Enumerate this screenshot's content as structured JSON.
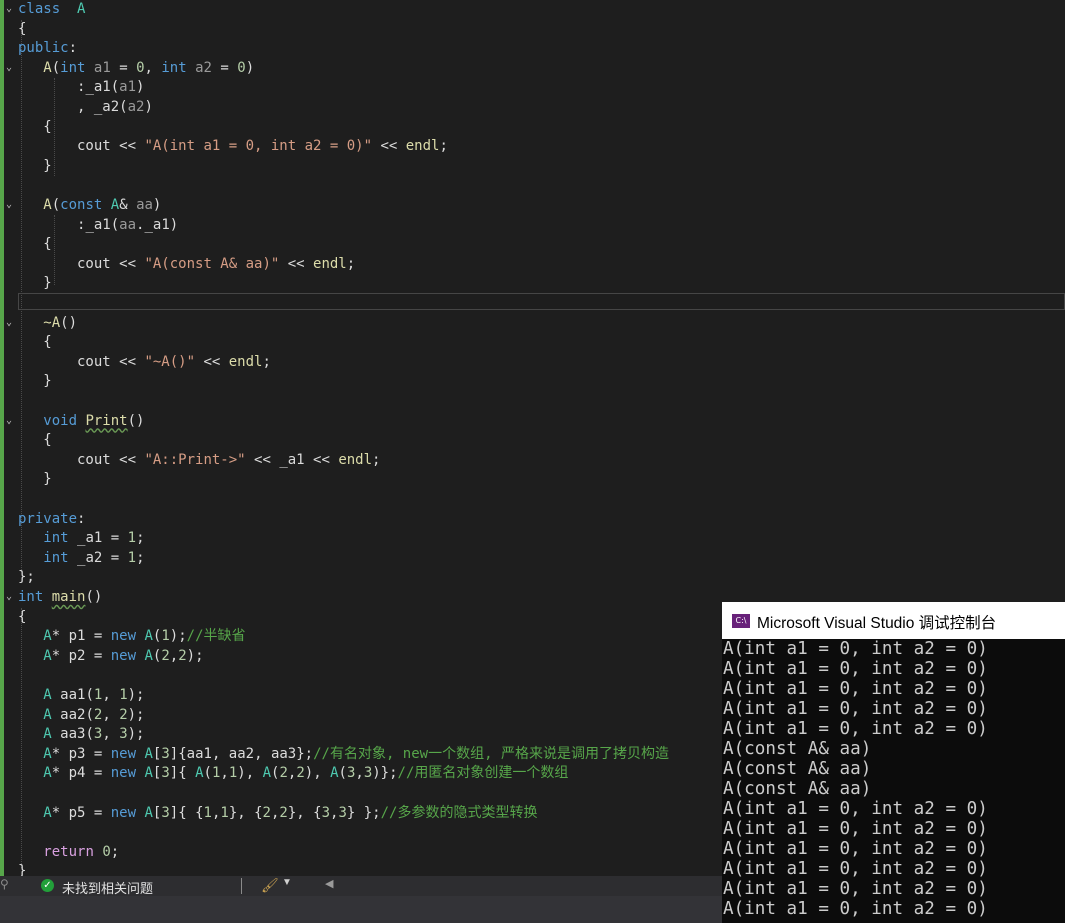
{
  "editor": {
    "code": [
      {
        "parts": [
          [
            "kw",
            "class"
          ],
          [
            "",
            "  "
          ],
          [
            "ty",
            "A"
          ]
        ]
      },
      {
        "parts": [
          [
            "",
            "{"
          ]
        ]
      },
      {
        "parts": [
          [
            "kw",
            "public"
          ],
          [
            "",
            ":"
          ]
        ]
      },
      {
        "parts": [
          [
            "",
            "   "
          ],
          [
            "fn",
            "A"
          ],
          [
            "",
            "("
          ],
          [
            "kw",
            "int"
          ],
          [
            "",
            " "
          ],
          [
            "par",
            "a1"
          ],
          [
            "",
            " = "
          ],
          [
            "num",
            "0"
          ],
          [
            "",
            ", "
          ],
          [
            "kw",
            "int"
          ],
          [
            "",
            " "
          ],
          [
            "par",
            "a2"
          ],
          [
            "",
            " = "
          ],
          [
            "num",
            "0"
          ],
          [
            "",
            ")"
          ]
        ]
      },
      {
        "parts": [
          [
            "",
            "       :"
          ],
          [
            "mem",
            "_a1"
          ],
          [
            "",
            "("
          ],
          [
            "par",
            "a1"
          ],
          [
            "",
            ")"
          ]
        ]
      },
      {
        "parts": [
          [
            "",
            "       , "
          ],
          [
            "mem",
            "_a2"
          ],
          [
            "",
            "("
          ],
          [
            "par",
            "a2"
          ],
          [
            "",
            ")"
          ]
        ]
      },
      {
        "parts": [
          [
            "",
            "   {"
          ]
        ]
      },
      {
        "parts": [
          [
            "",
            "       cout << "
          ],
          [
            "str",
            "\"A(int a1 = 0, int a2 = 0)\""
          ],
          [
            "",
            " << "
          ],
          [
            "fn",
            "endl"
          ],
          [
            "",
            ";"
          ]
        ]
      },
      {
        "parts": [
          [
            "",
            "   }"
          ]
        ]
      },
      {
        "parts": [
          [
            "",
            ""
          ]
        ]
      },
      {
        "parts": [
          [
            "",
            "   "
          ],
          [
            "fn",
            "A"
          ],
          [
            "",
            "("
          ],
          [
            "kw",
            "const"
          ],
          [
            "",
            " "
          ],
          [
            "ty",
            "A"
          ],
          [
            "",
            "& "
          ],
          [
            "par",
            "aa"
          ],
          [
            "",
            ")"
          ]
        ]
      },
      {
        "parts": [
          [
            "",
            "       :"
          ],
          [
            "mem",
            "_a1"
          ],
          [
            "",
            "("
          ],
          [
            "par",
            "aa"
          ],
          [
            "",
            "."
          ],
          [
            "mem",
            "_a1"
          ],
          [
            "",
            ")"
          ]
        ]
      },
      {
        "parts": [
          [
            "",
            "   {"
          ]
        ]
      },
      {
        "parts": [
          [
            "",
            "       cout << "
          ],
          [
            "str",
            "\"A(const A& aa)\""
          ],
          [
            "",
            " << "
          ],
          [
            "fn",
            "endl"
          ],
          [
            "",
            ";"
          ]
        ]
      },
      {
        "parts": [
          [
            "",
            "   }"
          ]
        ]
      },
      {
        "parts": [
          [
            "",
            ""
          ]
        ]
      },
      {
        "parts": [
          [
            "",
            "   "
          ],
          [
            "fn",
            "~A"
          ],
          [
            "",
            "()"
          ]
        ]
      },
      {
        "parts": [
          [
            "",
            "   {"
          ]
        ]
      },
      {
        "parts": [
          [
            "",
            "       cout << "
          ],
          [
            "str",
            "\"~A()\""
          ],
          [
            "",
            " << "
          ],
          [
            "fn",
            "endl"
          ],
          [
            "",
            ";"
          ]
        ]
      },
      {
        "parts": [
          [
            "",
            "   }"
          ]
        ]
      },
      {
        "parts": [
          [
            "",
            ""
          ]
        ]
      },
      {
        "parts": [
          [
            "",
            "   "
          ],
          [
            "kw",
            "void"
          ],
          [
            "",
            " "
          ],
          [
            "fn-u",
            "Print"
          ],
          [
            "",
            "()"
          ]
        ]
      },
      {
        "parts": [
          [
            "",
            "   {"
          ]
        ]
      },
      {
        "parts": [
          [
            "",
            "       cout << "
          ],
          [
            "str",
            "\"A::Print->\""
          ],
          [
            "",
            " << "
          ],
          [
            "mem",
            "_a1"
          ],
          [
            "",
            " << "
          ],
          [
            "fn",
            "endl"
          ],
          [
            "",
            ";"
          ]
        ]
      },
      {
        "parts": [
          [
            "",
            "   }"
          ]
        ]
      },
      {
        "parts": [
          [
            "",
            ""
          ]
        ]
      },
      {
        "parts": [
          [
            "kw",
            "private"
          ],
          [
            "",
            ":"
          ]
        ]
      },
      {
        "parts": [
          [
            "",
            "   "
          ],
          [
            "kw",
            "int"
          ],
          [
            "",
            " "
          ],
          [
            "mem",
            "_a1"
          ],
          [
            "",
            " = "
          ],
          [
            "num",
            "1"
          ],
          [
            "",
            ";"
          ]
        ]
      },
      {
        "parts": [
          [
            "",
            "   "
          ],
          [
            "kw",
            "int"
          ],
          [
            "",
            " "
          ],
          [
            "mem",
            "_a2"
          ],
          [
            "",
            " = "
          ],
          [
            "num",
            "1"
          ],
          [
            "",
            ";"
          ]
        ]
      },
      {
        "parts": [
          [
            "",
            "};"
          ]
        ]
      },
      {
        "parts": [
          [
            "kw",
            "int"
          ],
          [
            "",
            " "
          ],
          [
            "fn-u",
            "main"
          ],
          [
            "",
            "()"
          ]
        ]
      },
      {
        "parts": [
          [
            "",
            "{"
          ]
        ]
      },
      {
        "parts": [
          [
            "",
            "   "
          ],
          [
            "ty",
            "A"
          ],
          [
            "",
            "* "
          ],
          [
            "",
            "p1"
          ],
          [
            "",
            " = "
          ],
          [
            "kw",
            "new"
          ],
          [
            "",
            " "
          ],
          [
            "ty",
            "A"
          ],
          [
            "",
            "("
          ],
          [
            "num",
            "1"
          ],
          [
            "",
            ");"
          ],
          [
            "cm",
            "//半缺省"
          ]
        ]
      },
      {
        "parts": [
          [
            "",
            "   "
          ],
          [
            "ty",
            "A"
          ],
          [
            "",
            "* "
          ],
          [
            "",
            "p2"
          ],
          [
            "",
            " = "
          ],
          [
            "kw",
            "new"
          ],
          [
            "",
            " "
          ],
          [
            "ty",
            "A"
          ],
          [
            "",
            "("
          ],
          [
            "num",
            "2"
          ],
          [
            "",
            ","
          ],
          [
            "num",
            "2"
          ],
          [
            "",
            ");"
          ]
        ]
      },
      {
        "parts": [
          [
            "",
            ""
          ]
        ]
      },
      {
        "parts": [
          [
            "",
            "   "
          ],
          [
            "ty",
            "A"
          ],
          [
            "",
            " aa1("
          ],
          [
            "num",
            "1"
          ],
          [
            "",
            ", "
          ],
          [
            "num",
            "1"
          ],
          [
            "",
            ");"
          ]
        ]
      },
      {
        "parts": [
          [
            "",
            "   "
          ],
          [
            "ty",
            "A"
          ],
          [
            "",
            " aa2("
          ],
          [
            "num",
            "2"
          ],
          [
            "",
            ", "
          ],
          [
            "num",
            "2"
          ],
          [
            "",
            ");"
          ]
        ]
      },
      {
        "parts": [
          [
            "",
            "   "
          ],
          [
            "ty",
            "A"
          ],
          [
            "",
            " aa3("
          ],
          [
            "num",
            "3"
          ],
          [
            "",
            ", "
          ],
          [
            "num",
            "3"
          ],
          [
            "",
            ");"
          ]
        ]
      },
      {
        "parts": [
          [
            "",
            "   "
          ],
          [
            "ty",
            "A"
          ],
          [
            "",
            "* "
          ],
          [
            "",
            "p3"
          ],
          [
            "",
            " = "
          ],
          [
            "kw",
            "new"
          ],
          [
            "",
            " "
          ],
          [
            "ty",
            "A"
          ],
          [
            "",
            "["
          ],
          [
            "num",
            "3"
          ],
          [
            "",
            "]{aa1, aa2, aa3};"
          ],
          [
            "cm",
            "//有名对象, new一个数组, 严格来说是调用了拷贝构造"
          ]
        ]
      },
      {
        "parts": [
          [
            "",
            "   "
          ],
          [
            "ty",
            "A"
          ],
          [
            "",
            "* "
          ],
          [
            "",
            "p4"
          ],
          [
            "",
            " = "
          ],
          [
            "kw",
            "new"
          ],
          [
            "",
            " "
          ],
          [
            "ty",
            "A"
          ],
          [
            "",
            "["
          ],
          [
            "num",
            "3"
          ],
          [
            "",
            "]{ "
          ],
          [
            "ty",
            "A"
          ],
          [
            "",
            "("
          ],
          [
            "num",
            "1"
          ],
          [
            "",
            ","
          ],
          [
            "num",
            "1"
          ],
          [
            "",
            "), "
          ],
          [
            "ty",
            "A"
          ],
          [
            "",
            "("
          ],
          [
            "num",
            "2"
          ],
          [
            "",
            ","
          ],
          [
            "num",
            "2"
          ],
          [
            "",
            "), "
          ],
          [
            "ty",
            "A"
          ],
          [
            "",
            "("
          ],
          [
            "num",
            "3"
          ],
          [
            "",
            ","
          ],
          [
            "num",
            "3"
          ],
          [
            "",
            ")};"
          ],
          [
            "cm",
            "//用匿名对象创建一个数组"
          ]
        ]
      },
      {
        "parts": [
          [
            "",
            ""
          ]
        ]
      },
      {
        "parts": [
          [
            "",
            "   "
          ],
          [
            "ty",
            "A"
          ],
          [
            "",
            "* "
          ],
          [
            "",
            "p5"
          ],
          [
            "",
            " = "
          ],
          [
            "kw",
            "new"
          ],
          [
            "",
            " "
          ],
          [
            "ty",
            "A"
          ],
          [
            "",
            "["
          ],
          [
            "num",
            "3"
          ],
          [
            "",
            "]{ {"
          ],
          [
            "num",
            "1"
          ],
          [
            "",
            ","
          ],
          [
            "num",
            "1"
          ],
          [
            "",
            "}, {"
          ],
          [
            "num",
            "2"
          ],
          [
            "",
            ","
          ],
          [
            "num",
            "2"
          ],
          [
            "",
            "}, {"
          ],
          [
            "num",
            "3"
          ],
          [
            "",
            ","
          ],
          [
            "num",
            "3"
          ],
          [
            "",
            "} };"
          ],
          [
            "cm",
            "//多参数的隐式类型转换"
          ]
        ]
      },
      {
        "parts": [
          [
            "",
            ""
          ]
        ]
      },
      {
        "parts": [
          [
            "",
            "   "
          ],
          [
            "ctrl",
            "return"
          ],
          [
            "",
            " "
          ],
          [
            "num",
            "0"
          ],
          [
            "",
            ";"
          ]
        ]
      },
      {
        "parts": [
          [
            "",
            "}"
          ]
        ]
      }
    ]
  },
  "statusbar": {
    "ok_icon": "check-circle-icon",
    "issues_text": "未找到相关问题",
    "brush_icon": "cleanup-brush-icon"
  },
  "console": {
    "title": "Microsoft Visual Studio 调试控制台",
    "icon_text": "C:\\",
    "lines": [
      "A(int a1 = 0, int a2 = 0)",
      "A(int a1 = 0, int a2 = 0)",
      "A(int a1 = 0, int a2 = 0)",
      "A(int a1 = 0, int a2 = 0)",
      "A(int a1 = 0, int a2 = 0)",
      "A(const A& aa)",
      "A(const A& aa)",
      "A(const A& aa)",
      "A(int a1 = 0, int a2 = 0)",
      "A(int a1 = 0, int a2 = 0)",
      "A(int a1 = 0, int a2 = 0)",
      "A(int a1 = 0, int a2 = 0)",
      "A(int a1 = 0, int a2 = 0)",
      "A(int a1 = 0, int a2 = 0)"
    ]
  }
}
